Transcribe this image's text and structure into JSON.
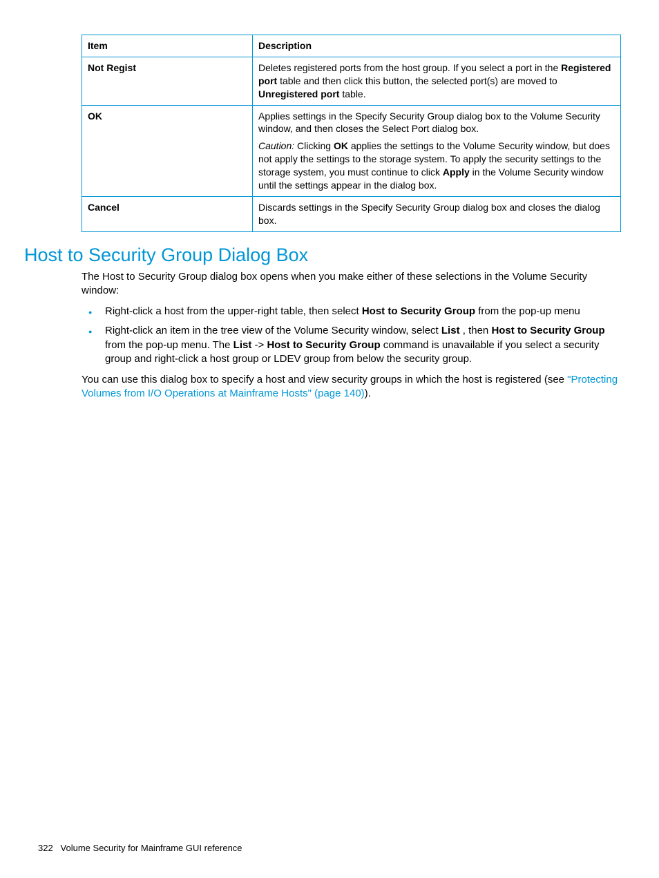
{
  "table": {
    "header": {
      "item": "Item",
      "desc": "Description"
    },
    "rows": [
      {
        "item": "Not Regist",
        "desc_p1_a": "Deletes registered ports from the host group. If you select a port in the ",
        "desc_p1_b": "Registered port",
        "desc_p1_c": " table and then click this button, the selected port(s) are moved to ",
        "desc_p1_d": "Unregistered port",
        "desc_p1_e": " table."
      },
      {
        "item": "OK",
        "desc_p1": "Applies settings in the Specify Security Group dialog box to the Volume Security window, and then closes the Select Port dialog box.",
        "desc_p2_a": "Caution:",
        "desc_p2_b": " Clicking ",
        "desc_p2_c": "OK",
        "desc_p2_d": " applies the settings to the Volume Security window, but does not apply the settings to the storage system. To apply the security settings to the storage system, you must continue to click ",
        "desc_p2_e": "Apply",
        "desc_p2_f": " in the Volume Security window until the settings appear in the dialog box."
      },
      {
        "item": "Cancel",
        "desc_p1": "Discards settings in the Specify Security Group dialog box and closes the dialog box."
      }
    ]
  },
  "heading": "Host to Security Group Dialog Box",
  "intro": "The Host to Security Group dialog box opens when you make either of these selections in the Volume Security window:",
  "bullet1_a": "Right-click a host from the upper-right table, then select ",
  "bullet1_b": "Host to Security Group",
  "bullet1_c": " from the pop-up menu",
  "bullet2_a": "Right-click an item in the tree view of the Volume Security window, select ",
  "bullet2_b": "List",
  "bullet2_c": " , then ",
  "bullet2_d": "Host to Security Group",
  "bullet2_e": " from the pop-up menu. The ",
  "bullet2_f": "List",
  "bullet2_g": "  -> ",
  "bullet2_h": "Host to Security Group",
  "bullet2_i": " command is unavailable if you select a security group and right-click a host group or LDEV group from below the security group.",
  "para2_a": "You can use this dialog box to specify a host and view security groups in which the host is registered (see ",
  "para2_link": "\"Protecting Volumes from I/O Operations at Mainframe Hosts\" (page 140)",
  "para2_b": ").",
  "footer_page": "322",
  "footer_text": "Volume Security for Mainframe GUI reference"
}
